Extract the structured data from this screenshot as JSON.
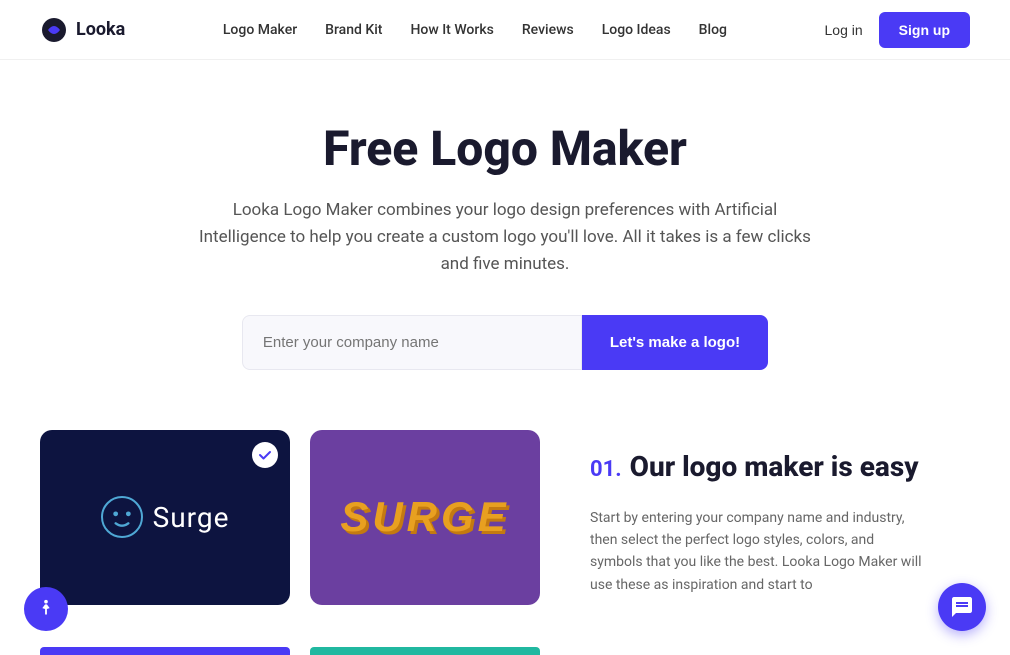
{
  "brand": {
    "name": "Looka",
    "logo_icon": "looka"
  },
  "nav": {
    "links": [
      {
        "label": "Logo Maker",
        "id": "logo-maker"
      },
      {
        "label": "Brand Kit",
        "id": "brand-kit"
      },
      {
        "label": "How It Works",
        "id": "how-it-works"
      },
      {
        "label": "Reviews",
        "id": "reviews"
      },
      {
        "label": "Logo Ideas",
        "id": "logo-ideas"
      },
      {
        "label": "Blog",
        "id": "blog"
      }
    ],
    "login_label": "Log in",
    "signup_label": "Sign up"
  },
  "hero": {
    "title": "Free Logo Maker",
    "description": "Looka Logo Maker combines your logo design preferences with Artificial Intelligence to help you create a custom logo you'll love. All it takes is a few clicks and five minutes.",
    "input_placeholder": "Enter your company name",
    "cta_label": "Let's make a logo!"
  },
  "info": {
    "number": "01.",
    "title": "Our logo maker is easy",
    "description": "Start by entering your company name and industry, then select the perfect logo styles, colors, and symbols that you like the best. Looka Logo Maker will use these as inspiration and start to"
  },
  "logos": {
    "surge_light_text": "Surge",
    "surge_retro_text": "SURGE"
  }
}
